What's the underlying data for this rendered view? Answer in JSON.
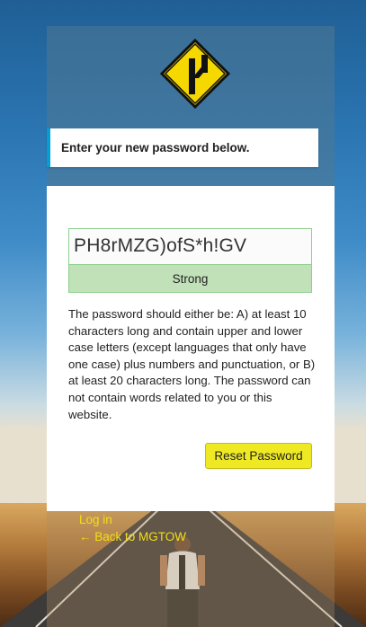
{
  "message": {
    "text": "Enter your new password below."
  },
  "form": {
    "password_value": "PH8rMZG)ofS*h!GV",
    "strength_label": "Strong",
    "hint": "The password should either be: A) at least 10 characters long and contain upper and lower case letters (except languages that only have one case) plus numbers and punctuation, or B) at least 20 characters long. The password can not contain words related to you or this website.",
    "submit_label": "Reset Password"
  },
  "nav": {
    "login_label": "Log in",
    "back_label": "← Back to MGTOW"
  },
  "colors": {
    "accent_border": "#00a0d2",
    "strength_bg": "#c1e1b9",
    "button_yellow": "#efe924",
    "link_yellow": "#f3df16",
    "logo_yellow": "#f5d800"
  },
  "icons": {
    "logo": "diverging-road-sign-icon",
    "back_arrow": "arrow-left"
  }
}
